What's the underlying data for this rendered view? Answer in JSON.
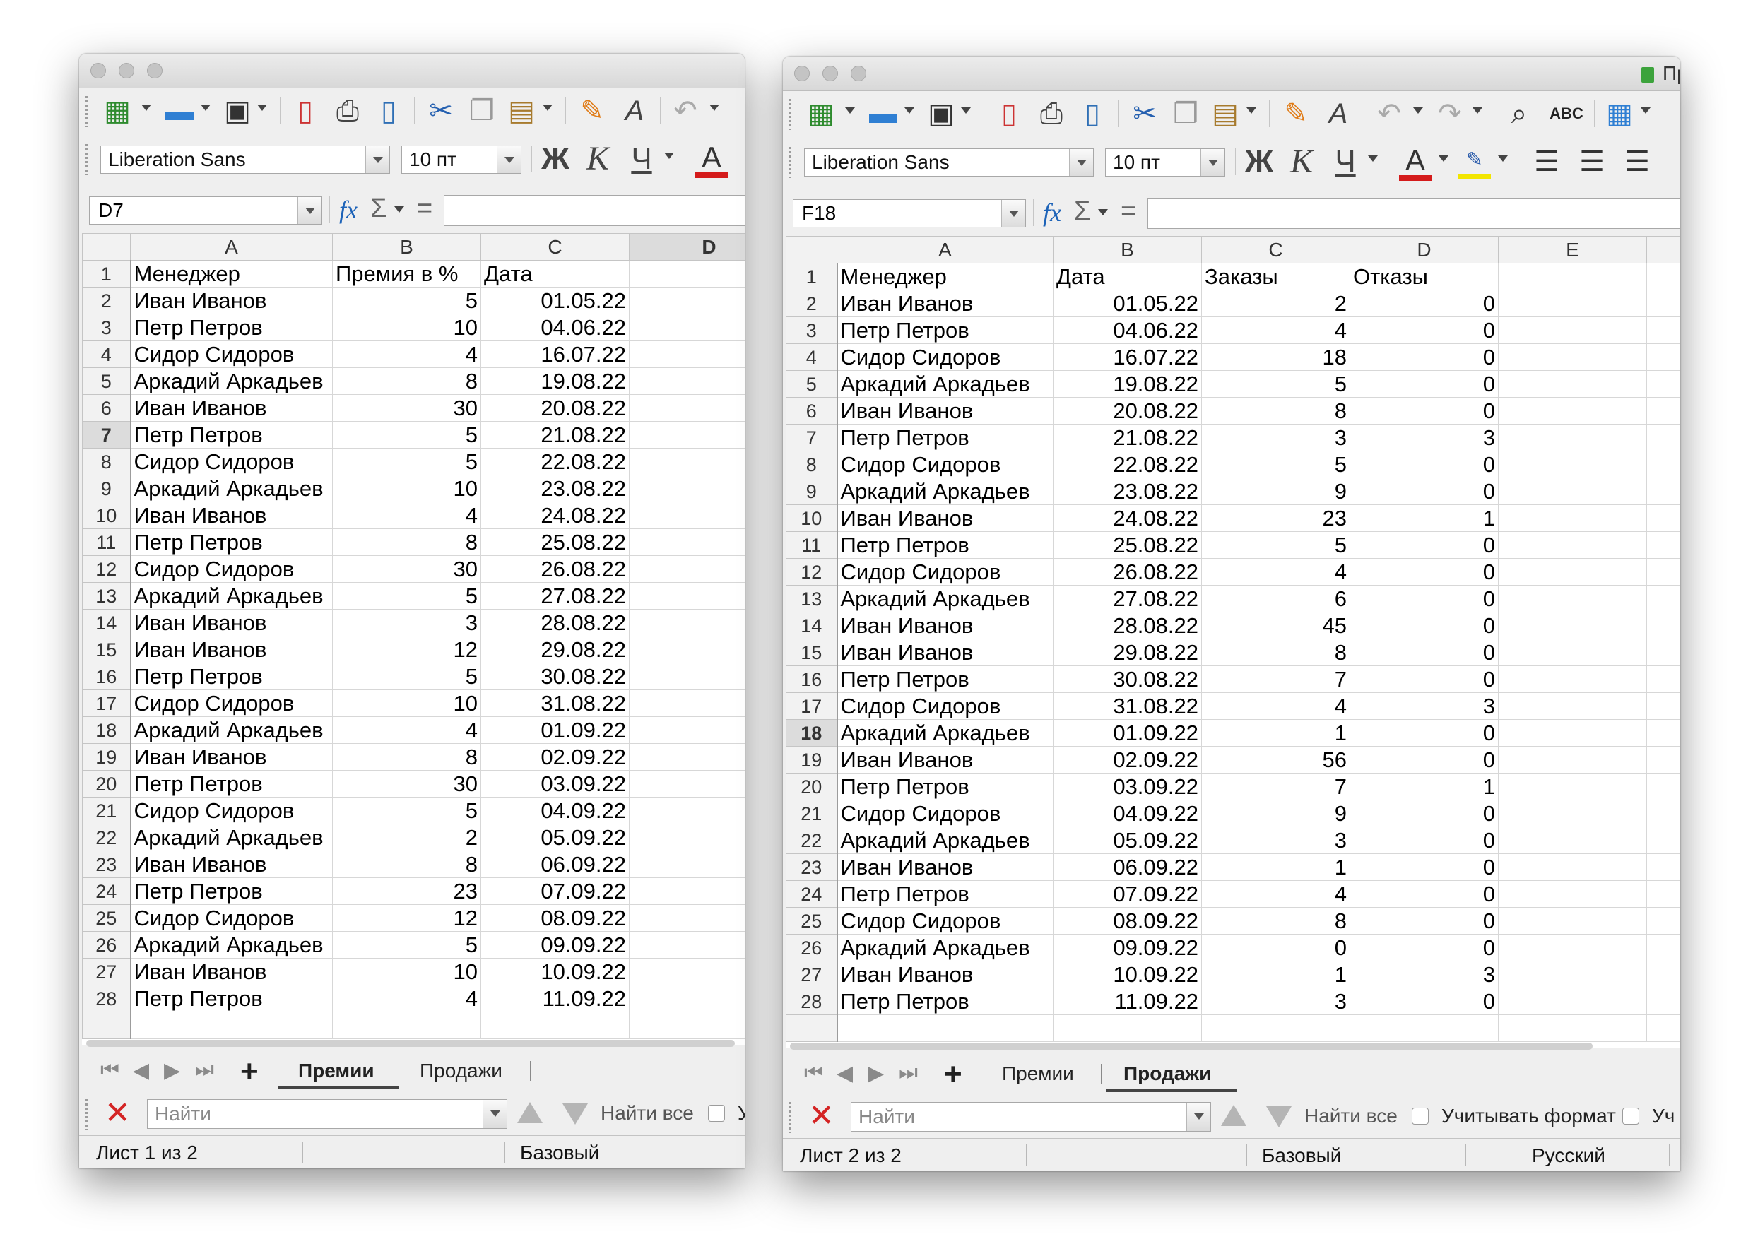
{
  "colors": {
    "accent_red": "#d41b1b",
    "highlight_yellow": "#f2e500",
    "fx_blue": "#1d63b8"
  },
  "window1": {
    "font_name": "Liberation Sans",
    "font_size": "10 пт",
    "format_bold": "Ж",
    "format_italic": "К",
    "format_underline": "Ч",
    "font_color_glyph": "A",
    "name_box": "D7",
    "columns": [
      "A",
      "B",
      "C",
      "D"
    ],
    "active_column": "D",
    "active_row": 7,
    "header_row": [
      "Менеджер",
      "Премия в %",
      "Дата",
      ""
    ],
    "rows": [
      [
        "Иван Иванов",
        "5",
        "01.05.22"
      ],
      [
        "Петр Петров",
        "10",
        "04.06.22"
      ],
      [
        "Сидор Сидоров",
        "4",
        "16.07.22"
      ],
      [
        "Аркадий Аркадьев",
        "8",
        "19.08.22"
      ],
      [
        "Иван Иванов",
        "30",
        "20.08.22"
      ],
      [
        "Петр Петров",
        "5",
        "21.08.22"
      ],
      [
        "Сидор Сидоров",
        "5",
        "22.08.22"
      ],
      [
        "Аркадий Аркадьев",
        "10",
        "23.08.22"
      ],
      [
        "Иван Иванов",
        "4",
        "24.08.22"
      ],
      [
        "Петр Петров",
        "8",
        "25.08.22"
      ],
      [
        "Сидор Сидоров",
        "30",
        "26.08.22"
      ],
      [
        "Аркадий Аркадьев",
        "5",
        "27.08.22"
      ],
      [
        "Иван Иванов",
        "3",
        "28.08.22"
      ],
      [
        "Иван Иванов",
        "12",
        "29.08.22"
      ],
      [
        "Петр Петров",
        "5",
        "30.08.22"
      ],
      [
        "Сидор Сидоров",
        "10",
        "31.08.22"
      ],
      [
        "Аркадий Аркадьев",
        "4",
        "01.09.22"
      ],
      [
        "Иван Иванов",
        "8",
        "02.09.22"
      ],
      [
        "Петр Петров",
        "30",
        "03.09.22"
      ],
      [
        "Сидор Сидоров",
        "5",
        "04.09.22"
      ],
      [
        "Аркадий Аркадьев",
        "2",
        "05.09.22"
      ],
      [
        "Иван Иванов",
        "8",
        "06.09.22"
      ],
      [
        "Петр Петров",
        "23",
        "07.09.22"
      ],
      [
        "Сидор Сидоров",
        "12",
        "08.09.22"
      ],
      [
        "Аркадий Аркадьев",
        "5",
        "09.09.22"
      ],
      [
        "Иван Иванов",
        "10",
        "10.09.22"
      ],
      [
        "Петр Петров",
        "4",
        "11.09.22"
      ]
    ],
    "tabs": [
      "Премии",
      "Продажи"
    ],
    "active_tab": 0,
    "find_placeholder": "Найти",
    "find_all": "Найти все",
    "find_cut_label": "У",
    "status_sheet": "Лист 1 из 2",
    "status_style": "Базовый"
  },
  "window2": {
    "title_fragment": "Пр",
    "font_name": "Liberation Sans",
    "font_size": "10 пт",
    "format_bold": "Ж",
    "format_italic": "К",
    "format_underline": "Ч",
    "font_color_glyph": "A",
    "spellcheck_label": "ABC",
    "name_box": "F18",
    "columns": [
      "A",
      "B",
      "C",
      "D",
      "E"
    ],
    "active_row": 18,
    "header_row": [
      "Менеджер",
      "Дата",
      "Заказы",
      "Отказы",
      ""
    ],
    "rows": [
      [
        "Иван Иванов",
        "01.05.22",
        "2",
        "0"
      ],
      [
        "Петр Петров",
        "04.06.22",
        "4",
        "0"
      ],
      [
        "Сидор Сидоров",
        "16.07.22",
        "18",
        "0"
      ],
      [
        "Аркадий Аркадьев",
        "19.08.22",
        "5",
        "0"
      ],
      [
        "Иван Иванов",
        "20.08.22",
        "8",
        "0"
      ],
      [
        "Петр Петров",
        "21.08.22",
        "3",
        "3"
      ],
      [
        "Сидор Сидоров",
        "22.08.22",
        "5",
        "0"
      ],
      [
        "Аркадий Аркадьев",
        "23.08.22",
        "9",
        "0"
      ],
      [
        "Иван Иванов",
        "24.08.22",
        "23",
        "1"
      ],
      [
        "Петр Петров",
        "25.08.22",
        "5",
        "0"
      ],
      [
        "Сидор Сидоров",
        "26.08.22",
        "4",
        "0"
      ],
      [
        "Аркадий Аркадьев",
        "27.08.22",
        "6",
        "0"
      ],
      [
        "Иван Иванов",
        "28.08.22",
        "45",
        "0"
      ],
      [
        "Иван Иванов",
        "29.08.22",
        "8",
        "0"
      ],
      [
        "Петр Петров",
        "30.08.22",
        "7",
        "0"
      ],
      [
        "Сидор Сидоров",
        "31.08.22",
        "4",
        "3"
      ],
      [
        "Аркадий Аркадьев",
        "01.09.22",
        "1",
        "0"
      ],
      [
        "Иван Иванов",
        "02.09.22",
        "56",
        "0"
      ],
      [
        "Петр Петров",
        "03.09.22",
        "7",
        "1"
      ],
      [
        "Сидор Сидоров",
        "04.09.22",
        "9",
        "0"
      ],
      [
        "Аркадий Аркадьев",
        "05.09.22",
        "3",
        "0"
      ],
      [
        "Иван Иванов",
        "06.09.22",
        "1",
        "0"
      ],
      [
        "Петр Петров",
        "07.09.22",
        "4",
        "0"
      ],
      [
        "Сидор Сидоров",
        "08.09.22",
        "8",
        "0"
      ],
      [
        "Аркадий Аркадьев",
        "09.09.22",
        "0",
        "0"
      ],
      [
        "Иван Иванов",
        "10.09.22",
        "1",
        "3"
      ],
      [
        "Петр Петров",
        "11.09.22",
        "3",
        "0"
      ]
    ],
    "tabs": [
      "Премии",
      "Продажи"
    ],
    "active_tab": 1,
    "find_placeholder": "Найти",
    "find_all": "Найти все",
    "match_format": "Учитывать формат",
    "find_cut_label": "Уч",
    "status_sheet": "Лист 2 из 2",
    "status_style": "Базовый",
    "status_lang": "Русский"
  }
}
